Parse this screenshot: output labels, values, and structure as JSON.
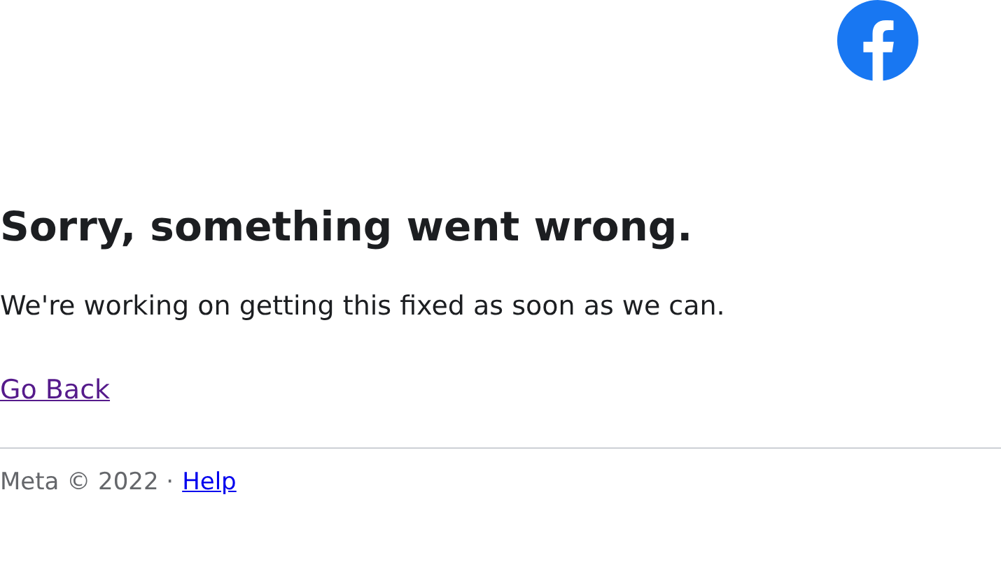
{
  "heading": "Sorry, something went wrong.",
  "message": "We're working on getting this fixed as soon as we can.",
  "back_link": "Go Back",
  "footer": {
    "copyright": "Meta © 2022 ·",
    "help_link": "Help"
  }
}
